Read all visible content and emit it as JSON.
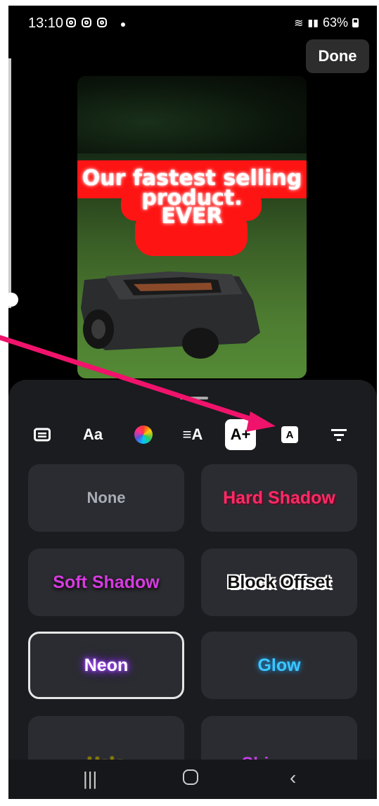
{
  "status_bar": {
    "time": "13:10",
    "battery": "63%",
    "icons": [
      "instagram-icon",
      "instagram-icon",
      "instagram-icon",
      "wifi-icon",
      "signal-icon",
      "battery-icon"
    ]
  },
  "header": {
    "done_label": "Done"
  },
  "preview": {
    "caption_lines": [
      "Our fastest selling",
      "product.",
      "EVER"
    ],
    "caption_bg_color": "#ff1414"
  },
  "toolbar": {
    "tools": [
      {
        "name": "keyboard-icon",
        "label": ""
      },
      {
        "name": "font-icon",
        "label": "Aa"
      },
      {
        "name": "color-wheel-icon",
        "label": ""
      },
      {
        "name": "align-icon",
        "label": "≡A"
      },
      {
        "name": "text-effects-icon",
        "label": "A+",
        "active": true
      },
      {
        "name": "text-background-icon",
        "label": "A"
      },
      {
        "name": "filter-icon",
        "label": ""
      }
    ]
  },
  "effects": {
    "options": [
      {
        "label": "None",
        "color": "#a9adb6"
      },
      {
        "label": "Hard Shadow",
        "color": "#ff2a66"
      },
      {
        "label": "Soft Shadow",
        "color": "#d63ae0"
      },
      {
        "label": "Block Offset",
        "color": "#111111"
      },
      {
        "label": "Neon",
        "color": "#ffffff",
        "selected": true
      },
      {
        "label": "Glow",
        "color": "#3ac8ff"
      },
      {
        "label": "Halo",
        "color": "#8a7a00"
      },
      {
        "label": "Shimmer",
        "color": "#c43ee8"
      }
    ]
  },
  "annotation": {
    "arrow_color": "#f0136b"
  }
}
